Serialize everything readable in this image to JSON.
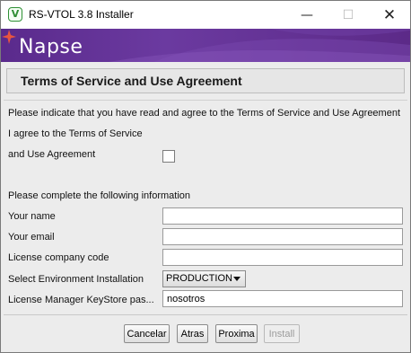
{
  "window": {
    "title": "RS-VTOL 3.8 Installer",
    "icon_letter": "V",
    "controls": {
      "minimize": "—",
      "maximize": "☐",
      "close": "✕"
    }
  },
  "banner": {
    "logo_text": "Napse",
    "brand_color": "#5a2a8c",
    "accent_color": "#e8553f"
  },
  "section": {
    "title": "Terms of Service and Use Agreement"
  },
  "agreement": {
    "instruction": "Please indicate that you have read and agree to the Terms of Service and Use Agreement",
    "label_line1": "I agree to the Terms of Service",
    "label_line2": "and Use Agreement",
    "checked": false
  },
  "form": {
    "instruction": "Please complete the following information",
    "fields": [
      {
        "label": "Your name",
        "value": ""
      },
      {
        "label": "Your email",
        "value": ""
      },
      {
        "label": "License company code",
        "value": ""
      }
    ],
    "environment": {
      "label": "Select Environment Installation",
      "selected": "PRODUCTION"
    },
    "keystore": {
      "label": "License Manager KeyStore pas...",
      "value": "nosotros"
    }
  },
  "buttons": {
    "cancel": "Cancelar",
    "back": "Atras",
    "next": "Proxima",
    "install": "Install"
  }
}
